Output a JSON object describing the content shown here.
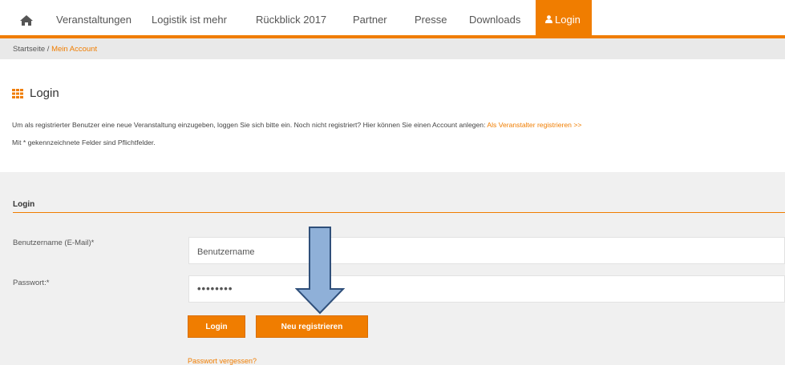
{
  "nav": {
    "items": [
      {
        "label": "Veranstaltungen"
      },
      {
        "label": "Logistik ist mehr"
      },
      {
        "label": "Rückblick 2017"
      },
      {
        "label": "Partner"
      },
      {
        "label": "Presse"
      },
      {
        "label": "Downloads"
      }
    ],
    "login_label": "Login",
    "home_icon": "home-icon",
    "user_icon": "user-icon"
  },
  "breadcrumb": {
    "home": "Startseite",
    "separator": " / ",
    "current": "Mein Account"
  },
  "page": {
    "title": "Login",
    "title_icon": "grid-icon",
    "intro_text": "Um als registrierter Benutzer eine neue Veranstaltung einzugeben, loggen Sie sich bitte ein. Noch nicht registriert? Hier können Sie einen Account anlegen: ",
    "intro_link": "Als Veranstalter registrieren >>",
    "required_note": "Mit * gekennzeichnete Felder sind Pflichtfelder."
  },
  "form": {
    "heading": "Login",
    "username_label": "Benutzername (E-Mail)*",
    "username_placeholder": "Benutzername",
    "password_label": "Passwort:*",
    "password_value": "••••••••",
    "login_button": "Login",
    "register_button": "Neu registrieren",
    "forgot_link": "Passwort vergessen?"
  },
  "colors": {
    "accent": "#f07d00",
    "breadcrumb_bg": "#e9e9e9",
    "panel_bg": "#f0f0f0",
    "arrow_fill": "#8fb0d8",
    "arrow_stroke": "#2f4f7a"
  }
}
